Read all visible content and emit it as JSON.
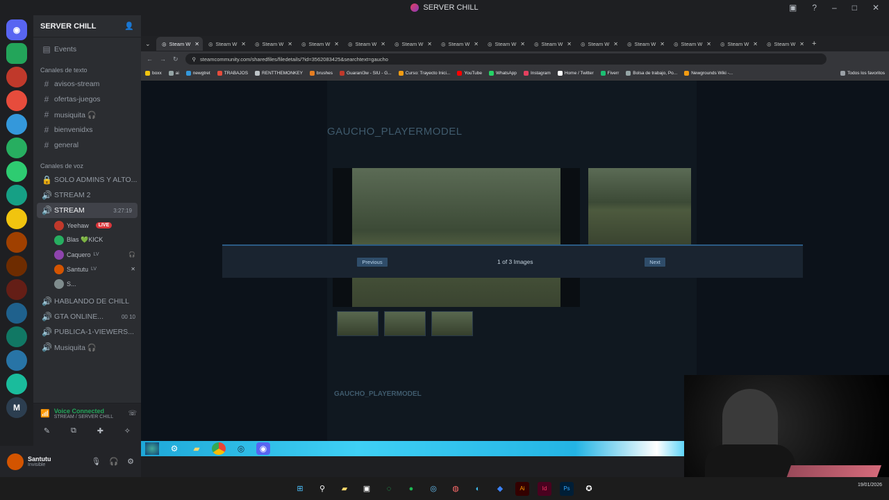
{
  "window": {
    "title": "SERVER CHILL"
  },
  "server": {
    "name": "SERVER CHILL"
  },
  "channels": {
    "events": "Events",
    "text_category": "Canales de texto",
    "text": [
      "avisos-stream",
      "ofertas-juegos",
      "musiquita 🎧",
      "bienvenidxs",
      "general"
    ],
    "voice_category": "Canales de voz",
    "voice_top": [
      "SOLO ADMINS Y ALTO...",
      "STREAM 2"
    ],
    "stream": {
      "name": "STREAM",
      "timer": "3:27:19"
    },
    "users": [
      {
        "name": "Yeehaw",
        "badge": "LIVE",
        "color": "#c0392b"
      },
      {
        "name": "Blas 💚KICK",
        "badge": "",
        "color": "#27ae60"
      },
      {
        "name": "Caquero",
        "badge": "LV",
        "color": "#8e44ad"
      },
      {
        "name": "Santutu",
        "badge": "LV",
        "color": "#d35400"
      },
      {
        "name": "S...",
        "badge": "",
        "color": "#7f8c8d"
      }
    ],
    "voice_bottom": [
      {
        "name": "HABLANDO DE CHILL",
        "count": ""
      },
      {
        "name": "GTA ONLINE...",
        "count": "00 10"
      },
      {
        "name": "PUBLICA-1-VIEWERS...",
        "count": ""
      },
      {
        "name": "Musiquita 🎧",
        "count": ""
      }
    ]
  },
  "voice_panel": {
    "status": "Voice Connected",
    "location": "STREAM / SERVER CHILL"
  },
  "user_panel": {
    "name": "Santutu",
    "status": "Invisible"
  },
  "browser": {
    "tabs": [
      "Steam W",
      "Steam W",
      "Steam W",
      "Steam W",
      "Steam W",
      "Steam W",
      "Steam W",
      "Steam W",
      "Steam W",
      "Steam W",
      "Steam W",
      "Steam W",
      "Steam W",
      "Steam W"
    ],
    "url": "steamcommunity.com/sharedfiles/filedetails/?id=3562083425&searchtext=gaucho",
    "bookmarks": [
      {
        "label": "boxx",
        "color": "#f1c40f"
      },
      {
        "label": "ai",
        "color": "#95a5a6"
      },
      {
        "label": "newgtret",
        "color": "#3498db"
      },
      {
        "label": "TRABAJOS",
        "color": "#e74c3c"
      },
      {
        "label": "RENTTHEMONKEY",
        "color": "#bdc3c7"
      },
      {
        "label": "brushes",
        "color": "#e67e22"
      },
      {
        "label": "Guaraní3w - SIU - G...",
        "color": "#c0392b"
      },
      {
        "label": "Curso: Trayecto Inici...",
        "color": "#f39c12"
      },
      {
        "label": "YouTube",
        "color": "#ff0000"
      },
      {
        "label": "WhatsApp",
        "color": "#25d366"
      },
      {
        "label": "Instagram",
        "color": "#e4405f"
      },
      {
        "label": "Home / Twitter",
        "color": "#ffffff"
      },
      {
        "label": "Fiverr",
        "color": "#1dbf73"
      },
      {
        "label": "Bolsa de trabajo, Po...",
        "color": "#95a5a6"
      },
      {
        "label": "Newgrounds Wiki -...",
        "color": "#f39c12"
      }
    ],
    "all_bookmarks": "Todos los favoritos"
  },
  "steam": {
    "title": "GAUCHO_PLAYERMODEL",
    "title_lower": "GAUCHO_PLAYERMODEL",
    "lightbox": {
      "prev": "Previous",
      "counter": "1 of 3 Images",
      "next": "Next"
    }
  },
  "tray": {
    "time": "",
    "date": "19/01/2026"
  },
  "colors": {
    "discord_bg": "#1e1f22",
    "channel_bg": "#2b2d31",
    "live": "#da373c",
    "overlay": "#3fd0f5"
  }
}
